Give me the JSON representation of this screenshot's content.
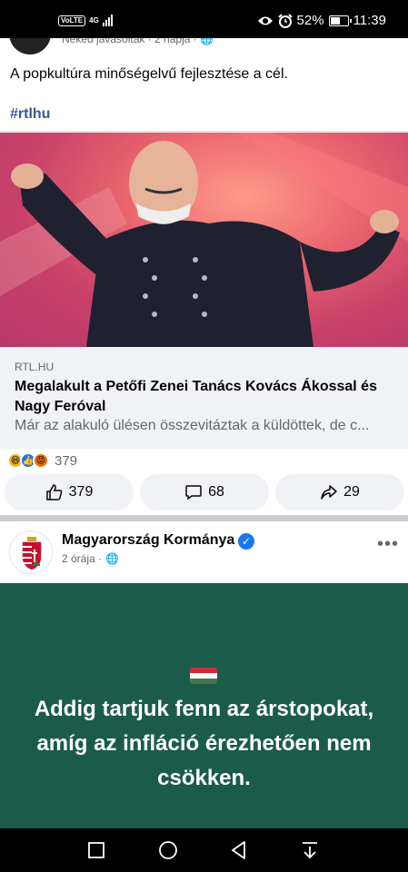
{
  "status_bar": {
    "network_badge": "VoLTE",
    "network_type": "4G",
    "battery": "52%",
    "battery_level": 0.52,
    "time": "11:39",
    "icons": [
      "eye-icon",
      "alarm-icon",
      "battery-icon",
      "signal-icon"
    ]
  },
  "post1": {
    "meta": "Neked javasoltak · 2 napja ·",
    "text": "A popkultúra minőségelvű fejlesztése a cél.",
    "hashtag": "#rtlhu",
    "link": {
      "domain": "RTL.HU",
      "title": "Megalakult a Petőfi Zenei Tanács Kovács Ákossal és Nagy Feróval",
      "description": "Már az alakuló ülésen összevitáztak a küldöttek, de c..."
    },
    "reaction_count": "379",
    "actions": {
      "like": "379",
      "comment": "68",
      "share": "29"
    }
  },
  "post2": {
    "page_name": "Magyarország Kormánya",
    "meta": "2 órája ·",
    "image_text": "Addig tartjuk fenn az árstopokat, amíg az infláció érezhetően nem csökken.",
    "background_color": "#1b5b4a"
  },
  "colors": {
    "accent": "#1877f2",
    "hashtag": "#385898"
  }
}
